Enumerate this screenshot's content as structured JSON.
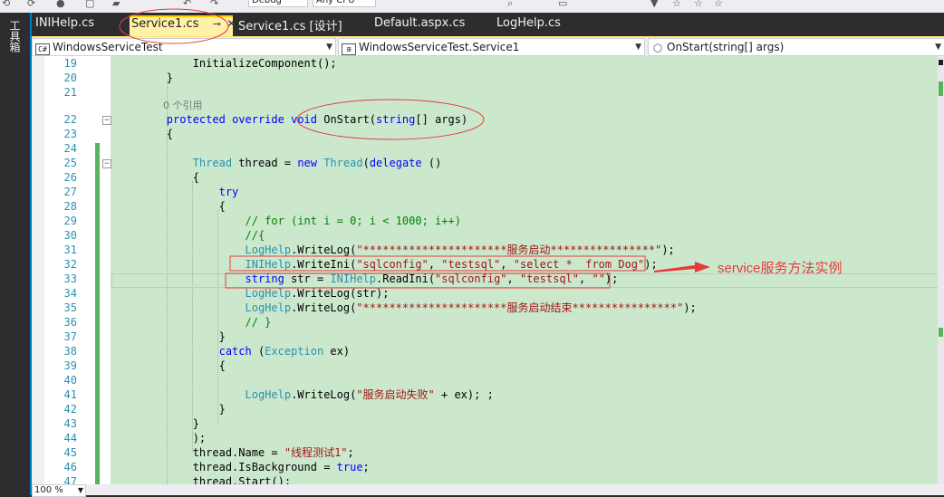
{
  "toolbar": {
    "config_value": "Debug",
    "platform_value": "Any CPU"
  },
  "toolstrip": {
    "label": "工具箱"
  },
  "tabs": [
    {
      "label": "INIHelp.cs",
      "active": false
    },
    {
      "label": "Service1.cs",
      "active": true
    },
    {
      "label": "Service1.cs [设计]",
      "active": false
    },
    {
      "label": "Default.aspx.cs",
      "active": false
    },
    {
      "label": "LogHelp.cs",
      "active": false
    }
  ],
  "nav": {
    "project": "WindowsServiceTest",
    "class": "WindowsServiceTest.Service1",
    "member": "OnStart(string[] args)"
  },
  "editor": {
    "references_hint": "0 个引用",
    "lines": [
      {
        "n": "19"
      },
      {
        "n": "20"
      },
      {
        "n": "21"
      },
      {
        "n": "22"
      },
      {
        "n": "23"
      },
      {
        "n": "24"
      },
      {
        "n": "25"
      },
      {
        "n": "26"
      },
      {
        "n": "27"
      },
      {
        "n": "28"
      },
      {
        "n": "29"
      },
      {
        "n": "30"
      },
      {
        "n": "31"
      },
      {
        "n": "32"
      },
      {
        "n": "33"
      },
      {
        "n": "34"
      },
      {
        "n": "35"
      },
      {
        "n": "36"
      },
      {
        "n": "37"
      },
      {
        "n": "38"
      },
      {
        "n": "39"
      },
      {
        "n": "40"
      },
      {
        "n": "41"
      },
      {
        "n": "42"
      },
      {
        "n": "43"
      },
      {
        "n": "44"
      },
      {
        "n": "45"
      },
      {
        "n": "46"
      },
      {
        "n": "47"
      }
    ]
  },
  "annotation": {
    "label": "service服务方法实例",
    "color": "#e53b3b"
  },
  "statusbar": {
    "zoom": "100 %"
  },
  "colors": {
    "accent": "#007acc",
    "active_tab": "#fff1a8",
    "code_background": "#cbe8cd",
    "change_bar": "#57b35c",
    "keyword": "#0000ff",
    "type": "#2b91af",
    "string": "#a31515",
    "comment": "#008000"
  }
}
